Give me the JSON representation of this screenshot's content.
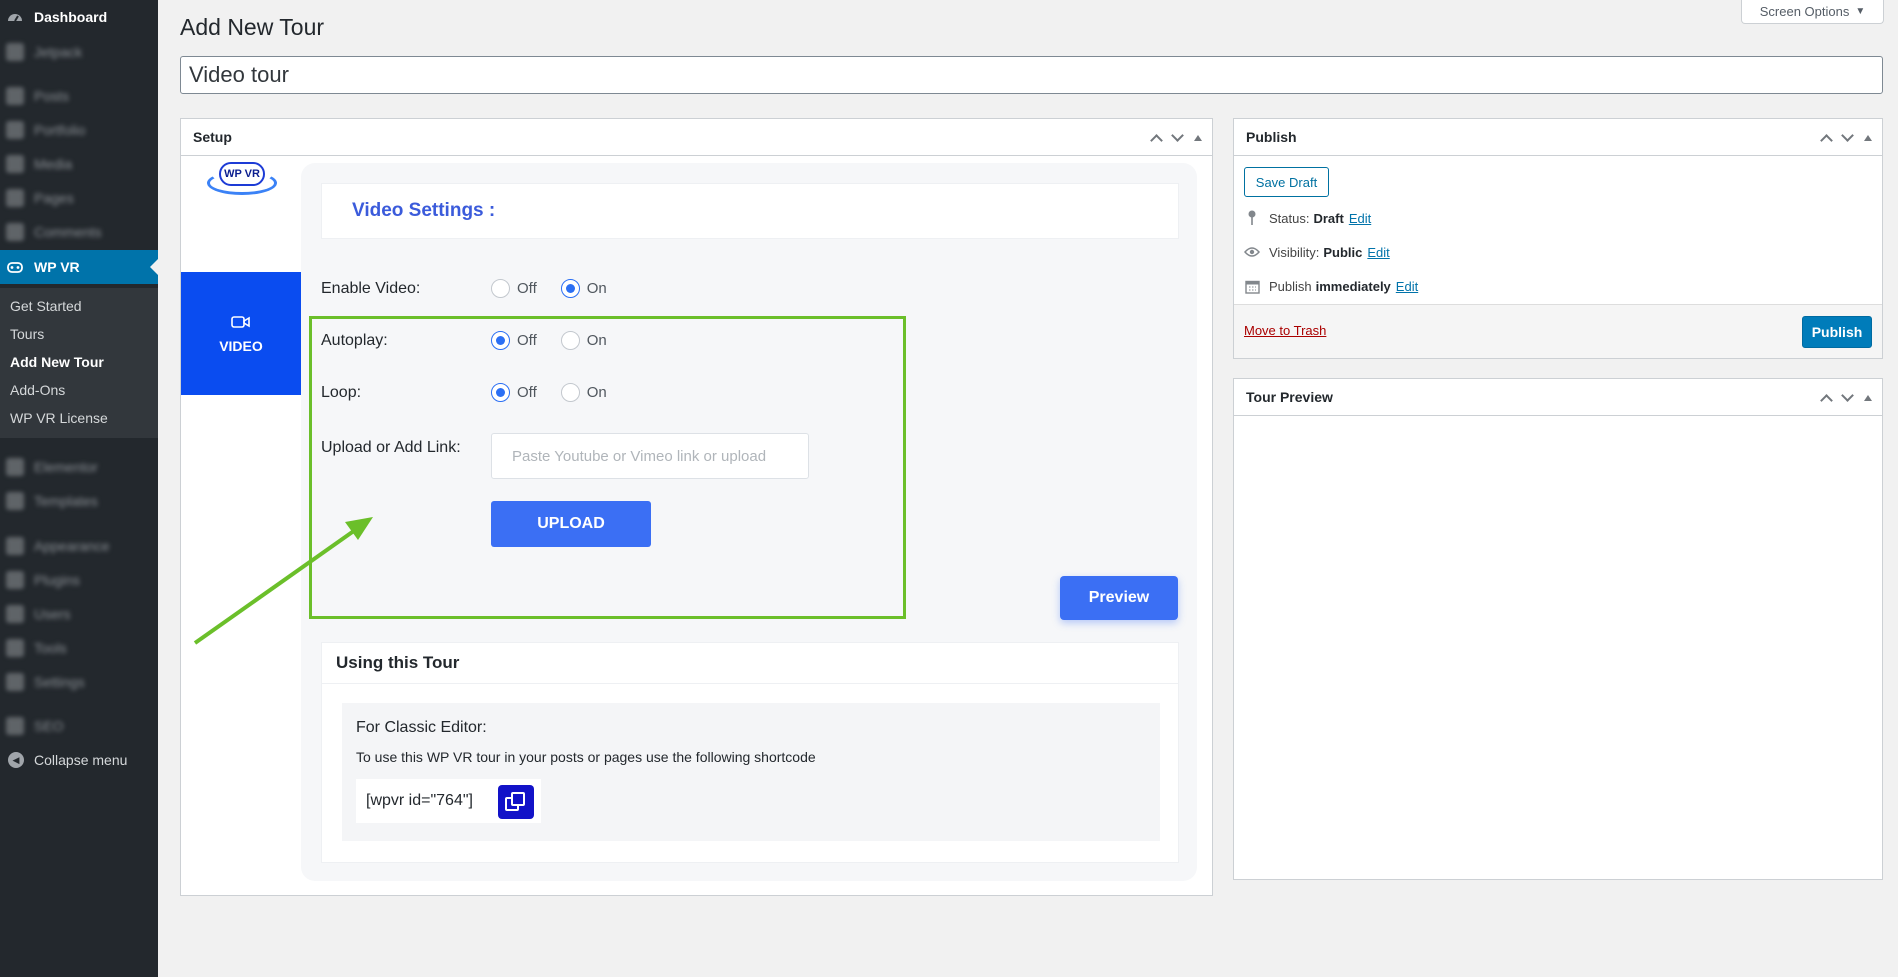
{
  "sidebar": {
    "dashboard": "Dashboard",
    "jetpack": "Jetpack",
    "posts": "Posts",
    "portfolio": "Portfolio",
    "media": "Media",
    "pages": "Pages",
    "comments": "Comments",
    "wpvr": "WP VR",
    "submenu": [
      "Get Started",
      "Tours",
      "Add New Tour",
      "Add-Ons",
      "WP VR License"
    ],
    "elementor": "Elementor",
    "templates": "Templates",
    "appearance": "Appearance",
    "plugins": "Plugins",
    "users": "Users",
    "tools": "Tools",
    "settings": "Settings",
    "seo": "SEO",
    "collapse": "Collapse menu"
  },
  "header": {
    "screen_options": "Screen Options",
    "page_title": "Add New Tour",
    "title_value": "Video tour"
  },
  "setup": {
    "title": "Setup",
    "logo_text": "WP VR",
    "tab_video": "VIDEO",
    "video_settings": "Video Settings :",
    "enable_label": "Enable Video:",
    "autoplay_label": "Autoplay:",
    "loop_label": "Loop:",
    "upload_label": "Upload or Add Link:",
    "off": "Off",
    "on": "On",
    "link_placeholder": "Paste Youtube or Vimeo link or upload",
    "upload_btn": "UPLOAD",
    "preview_btn": "Preview",
    "enable_value": "On",
    "autoplay_value": "Off",
    "loop_value": "Off"
  },
  "usage": {
    "title": "Using this Tour",
    "classic_title": "For Classic Editor:",
    "classic_desc": "To use this WP VR tour in your posts or pages use the following shortcode",
    "shortcode": "[wpvr id=\"764\"]"
  },
  "publish": {
    "title": "Publish",
    "save_draft": "Save Draft",
    "status_label": "Status:",
    "status_value": "Draft",
    "visibility_label": "Visibility:",
    "visibility_value": "Public",
    "publish_label": "Publish",
    "publish_value": "immediately",
    "edit": "Edit",
    "trash": "Move to Trash",
    "publish_btn": "Publish"
  },
  "tour_preview": {
    "title": "Tour Preview"
  },
  "colors": {
    "accent": "#3b6ff4",
    "sidebar": "#23282d",
    "highlight": "#6bbf2a",
    "wp_blue": "#007cba"
  }
}
